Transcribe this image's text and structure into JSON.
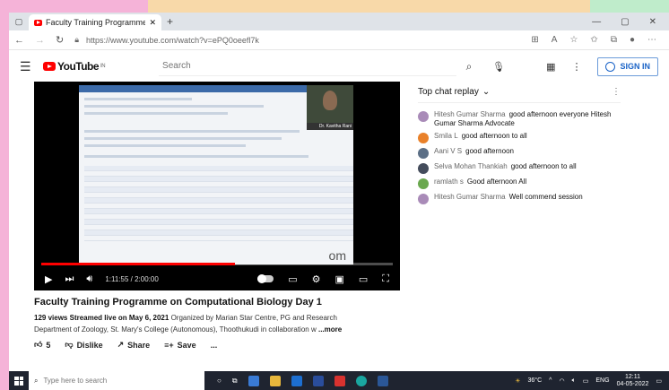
{
  "browser": {
    "tab_title": "Faculty Training Programme on",
    "new_tab": "+",
    "url": "https://www.youtube.com/watch?v=ePQ0oeefl7k",
    "win_min": "—",
    "win_max": "▢",
    "win_close": "✕"
  },
  "youtube": {
    "logo_text": "YouTube",
    "logo_sup": "IN",
    "search_placeholder": "Search",
    "signin_label": "SIGN IN"
  },
  "player": {
    "time": "1:11:55 / 2:00:00",
    "progress": 0.55,
    "presenter_caption": "Dr. Kavitha Rani",
    "watermark": "om"
  },
  "video": {
    "title": "Faculty Training Programme on Computational Biology Day 1",
    "views": "129 views",
    "streamed": "Streamed live on May 6, 2021",
    "desc_line1": "Organized by Marian Star Centre, PG and Research",
    "desc_line2": "Department of Zoology, St. Mary's College (Autonomous), Thoothukudi in collaboration w",
    "more": "...more",
    "likes": "5",
    "dislike": "Dislike",
    "share": "Share",
    "save": "Save",
    "more_actions": "..."
  },
  "chat": {
    "header": "Top chat replay",
    "messages": [
      {
        "author": "Hitesh Gumar Sharma",
        "text": "good afternoon everyone Hitesh Gumar Sharma Advocate",
        "color": "#a98bb8"
      },
      {
        "author": "Smila L",
        "text": "good afternoon to all",
        "color": "#e9812a"
      },
      {
        "author": "Aani V S",
        "text": "good afternoon",
        "color": "#5c6f86"
      },
      {
        "author": "Selva Mohan Thankiah",
        "text": "good afternoon to all",
        "color": "#444c5c"
      },
      {
        "author": "ramlath s",
        "text": "Good afternoon All",
        "color": "#6aa84f"
      },
      {
        "author": "Hitesh Gumar Sharma",
        "text": "Well commend session",
        "color": "#a98bb8"
      }
    ]
  },
  "taskbar": {
    "search_placeholder": "Type here to search",
    "temperature": "36°C",
    "lang": "ENG",
    "time": "12:11",
    "date": "04-05-2022"
  }
}
